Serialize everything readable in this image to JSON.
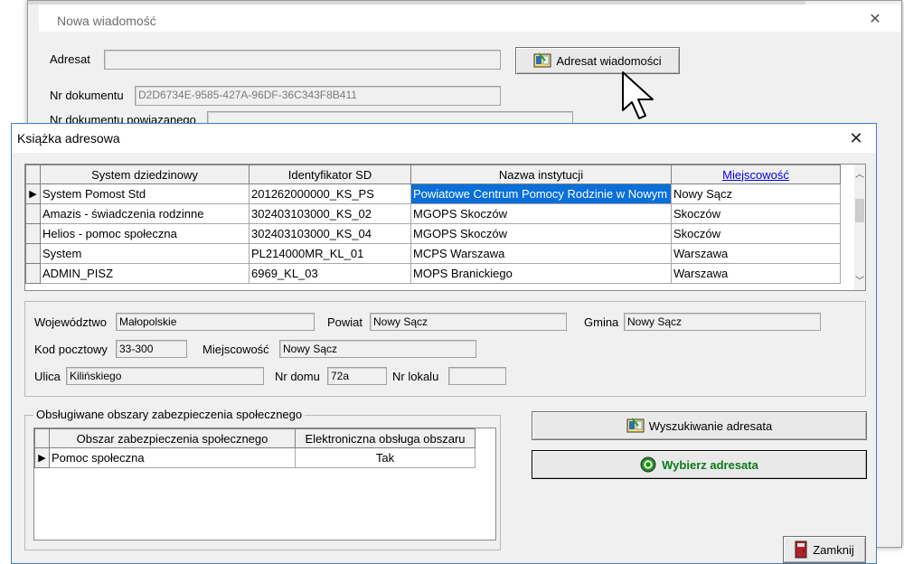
{
  "back_window": {
    "title": "Nowa wiadomość",
    "close_symbol": "✕",
    "adresat_label": "Adresat",
    "adresat_value": "",
    "adresat_button_label": "Adresat wiadomości",
    "nr_dokumentu_label": "Nr dokumentu",
    "nr_dokumentu_value": "D2D6734E-9585-427A-96DF-36C343F8B411",
    "nr_powiazanego_label": "Nr dokumentu powiązanego"
  },
  "address_book": {
    "title": "Książka adresowa",
    "close_symbol": "✕",
    "columns": [
      "System dziedzinowy",
      "Identyfikator SD",
      "Nazwa instytucji",
      "Miejscowość"
    ],
    "rows": [
      {
        "system": "System Pomost  Std",
        "id": "201262000000_KS_PS",
        "institution": "Powiatowe Centrum Pomocy Rodzinie w Nowym",
        "city": "Nowy Sącz",
        "selected": true
      },
      {
        "system": "Amazis - świadczenia rodzinne",
        "id": "302403103000_KS_02",
        "institution": "MGOPS Skoczów",
        "city": "Skoczów"
      },
      {
        "system": "Helios - pomoc społeczna",
        "id": "302403103000_KS_04",
        "institution": "MGOPS Skoczów",
        "city": "Skoczów"
      },
      {
        "system": "System",
        "id": "PL214000MR_KL_01",
        "institution": "MCPS Warszawa",
        "city": "Warszawa"
      },
      {
        "system": "ADMIN_PISZ",
        "id": "6969_KL_03",
        "institution": "MOPS Branickiego",
        "city": "Warszawa"
      }
    ],
    "details": {
      "wojewodztwo_label": "Województwo",
      "wojewodztwo": "Małopolskie",
      "powiat_label": "Powiat",
      "powiat": "Nowy Sącz",
      "gmina_label": "Gmina",
      "gmina": "Nowy Sącz",
      "kod_label": "Kod pocztowy",
      "kod": "33-300",
      "miejscowosc_label": "Miejscowość",
      "miejscowosc": "Nowy Sącz",
      "ulica_label": "Ulica",
      "ulica": "Kilińskiego",
      "nr_domu_label": "Nr domu",
      "nr_domu": "72a",
      "nr_lokalu_label": "Nr lokalu",
      "nr_lokalu": ""
    },
    "areas": {
      "group_title": "Obsługiwane obszary zabezpieczenia społecznego",
      "columns": [
        "Obszar zabezpieczenia społecznego",
        "Elektroniczna obsługa obszaru"
      ],
      "rows": [
        {
          "area": "Pomoc społeczna",
          "electronic": "Tak"
        }
      ]
    },
    "buttons": {
      "search": "Wyszukiwanie adresata",
      "choose": "Wybierz adresata",
      "close": "Zamknij"
    }
  },
  "colors": {
    "selection": "#0a6fd8",
    "link": "#0000ee",
    "choose_text": "#0a7a1a",
    "window_border": "#3c7fc6"
  }
}
